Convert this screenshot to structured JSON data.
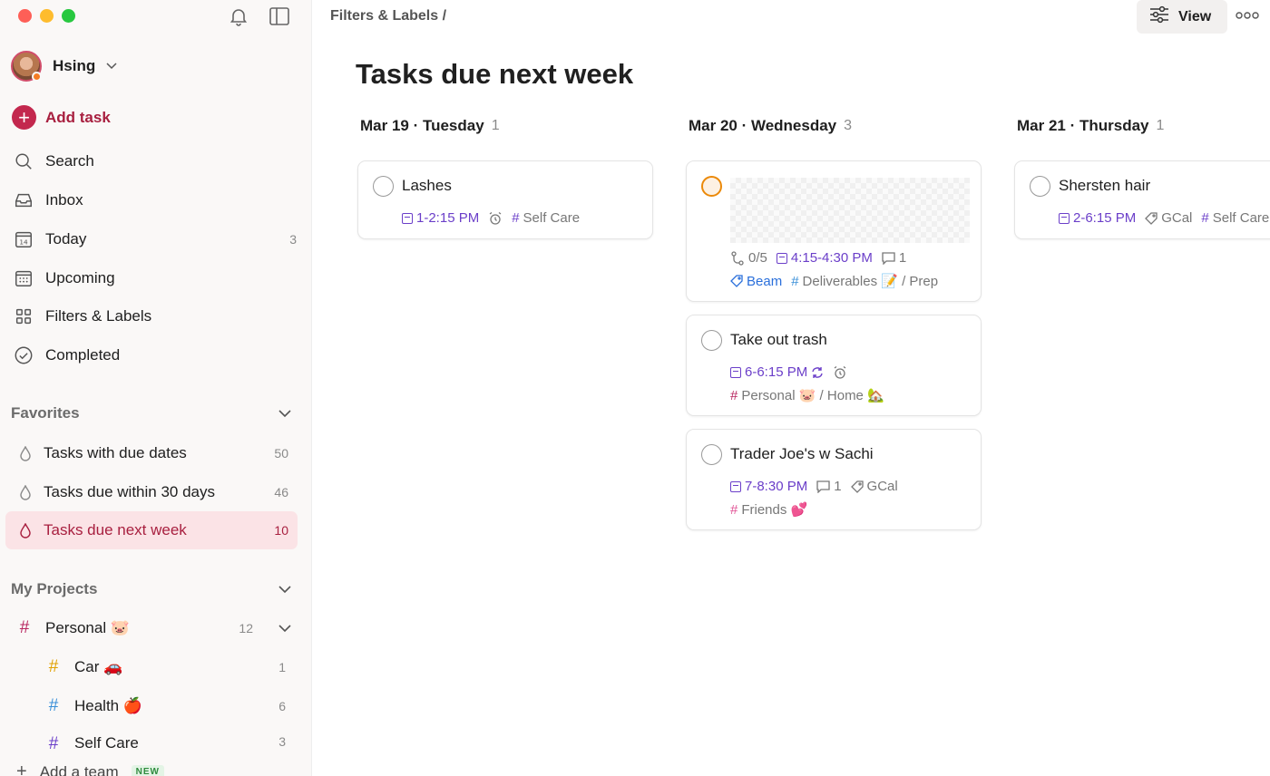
{
  "sidebar": {
    "user_name": "Hsing",
    "add_task": "Add task",
    "nav": [
      {
        "label": "Search",
        "count": "",
        "icon": "search-icon"
      },
      {
        "label": "Inbox",
        "count": "",
        "icon": "inbox-icon"
      },
      {
        "label": "Today",
        "count": "3",
        "icon": "calendar-today-icon"
      },
      {
        "label": "Upcoming",
        "count": "",
        "icon": "calendar-grid-icon"
      },
      {
        "label": "Filters & Labels",
        "count": "",
        "icon": "grid-icon"
      },
      {
        "label": "Completed",
        "count": "",
        "icon": "check-circle-icon"
      }
    ],
    "favorites_title": "Favorites",
    "favorites": [
      {
        "label": "Tasks with due dates",
        "count": "50"
      },
      {
        "label": "Tasks due within 30 days",
        "count": "46"
      },
      {
        "label": "Tasks due next week",
        "count": "10",
        "active": true
      }
    ],
    "projects_title": "My Projects",
    "projects": [
      {
        "label": "Personal 🐷",
        "count": "12",
        "color": "#b8255f"
      },
      {
        "label": "Car 🚗",
        "count": "1",
        "color": "#e0a100"
      },
      {
        "label": "Health 🍎",
        "count": "6",
        "color": "#3a8fd8"
      },
      {
        "label": "Self Care",
        "count": "3",
        "color": "#6b3fc9"
      }
    ],
    "add_team": "Add a team",
    "new_badge": "NEW"
  },
  "main": {
    "breadcrumb": "Filters & Labels /",
    "view_label": "View",
    "title": "Tasks due next week",
    "columns": [
      {
        "date": "Mar 19 · Tuesday",
        "count": "1",
        "cards": [
          {
            "title": "Lashes",
            "time": "1-2:15 PM",
            "project": "Self Care"
          }
        ]
      },
      {
        "date": "Mar 20 · Wednesday",
        "count": "3",
        "cards": [
          {
            "subtasks": "0/5",
            "time": "4:15-4:30 PM",
            "comments": "1",
            "label": "Beam",
            "project": "Deliverables 📝 / Prep"
          },
          {
            "title": "Take out trash",
            "time": "6-6:15 PM",
            "project": "Personal 🐷 / Home 🏡"
          },
          {
            "title": "Trader Joe's w Sachi",
            "time": "7-8:30 PM",
            "comments": "1",
            "label": "GCal",
            "project": "Friends 💕"
          }
        ]
      },
      {
        "date": "Mar 21 · Thursday",
        "count": "1",
        "cards": [
          {
            "title": "Shersten hair",
            "time": "2-6:15 PM",
            "label": "GCal",
            "project": "Self Care"
          }
        ]
      }
    ]
  },
  "colors": {
    "accent": "#c3284e",
    "active_bg": "#fbe3e6",
    "date_purple": "#6b3fc9",
    "label_blue": "#2a6fdb"
  }
}
